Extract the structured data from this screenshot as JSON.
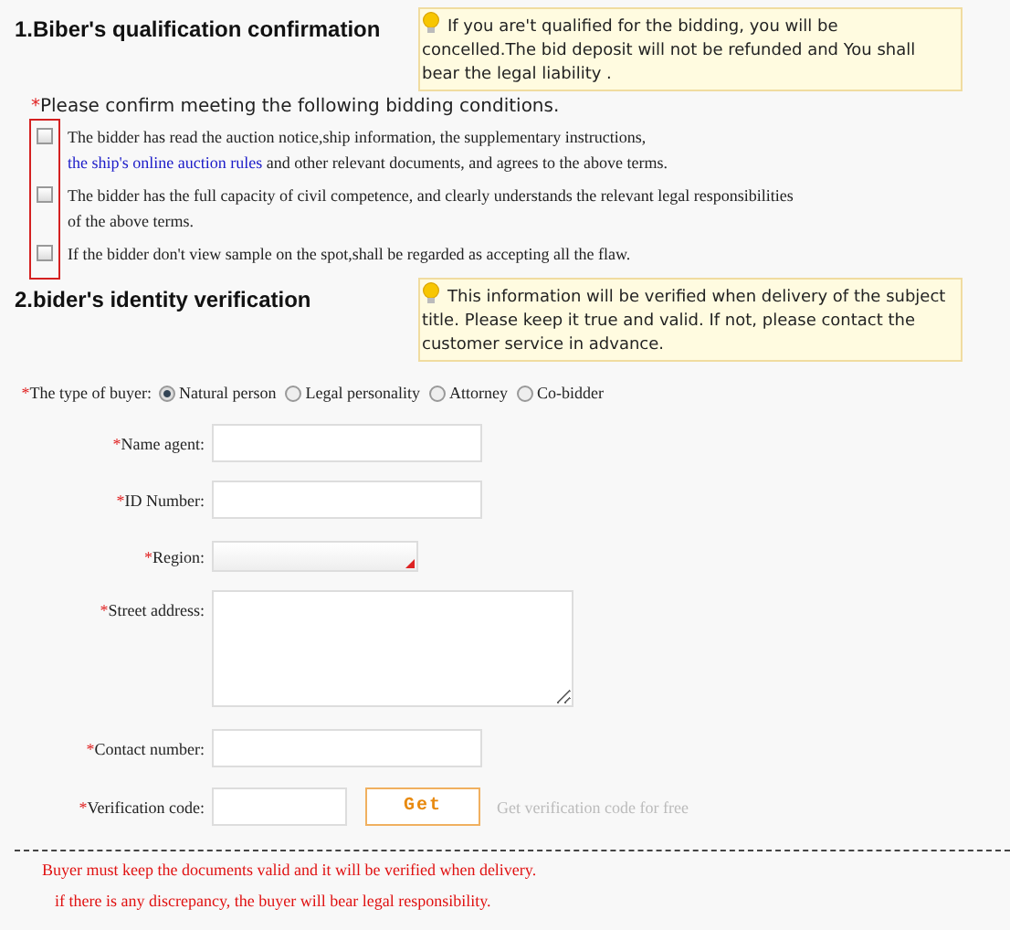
{
  "section1": {
    "title": "1.Biber's qualification confirmation",
    "tip": "If you are't qualified for the bidding, you will be concelled.The bid deposit will not be refunded and You shall bear the legal liability .",
    "marker": "*",
    "instruction": "Please confirm meeting the following bidding conditions.",
    "conditions": [
      {
        "checked": false,
        "text": "The bidder has read the auction notice,ship information, the supplementary instructions,",
        "link": "the ship's online auction rules",
        "after": "and other relevant documents, and agrees to the above terms."
      },
      {
        "checked": false,
        "text": "The bidder has the full capacity of civil competence, and clearly understands the relevant legal responsibilities of the above terms."
      },
      {
        "checked": false,
        "text": "If the bidder don't view sample on the spot,shall be regarded as accepting all the flaw."
      }
    ]
  },
  "section2": {
    "title": "2.bider's identity verification",
    "tip": "This information will be verified when delivery of the subject title. Please keep it true and valid. If not, please contact the customer service in advance.",
    "buyer_type": {
      "marker": "*",
      "label": "The type of buyer:",
      "options": [
        {
          "label": "Natural person",
          "selected": true
        },
        {
          "label": "Legal personality",
          "selected": false
        },
        {
          "label": "Attorney",
          "selected": false
        },
        {
          "label": "Co-bidder",
          "selected": false
        }
      ]
    },
    "fields": [
      {
        "kind": "text",
        "marker": "*",
        "label": "Name agent:"
      },
      {
        "kind": "text",
        "marker": "*",
        "label": "ID Number:"
      },
      {
        "kind": "select",
        "marker": "*",
        "label": "Region:"
      },
      {
        "kind": "textarea",
        "marker": "*",
        "label": "Street address:"
      },
      {
        "kind": "text",
        "marker": "*",
        "label": "Contact number:"
      },
      {
        "kind": "code",
        "marker": "*",
        "label": "Verification code:",
        "button": "Get",
        "hint": "Get verification code for free"
      }
    ]
  },
  "notes": [
    "Buyer must keep the documents valid and it will be verified when delivery.",
    "if there is any discrepancy, the buyer will bear legal responsibility."
  ]
}
